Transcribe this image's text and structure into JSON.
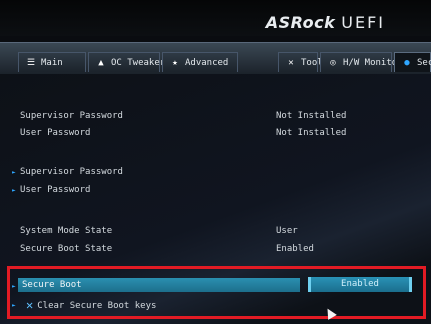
{
  "header": {
    "brand_name": "ASRock",
    "product": "UEFI"
  },
  "tabs": [
    {
      "label": "Main",
      "icon": "list-icon"
    },
    {
      "label": "OC Tweaker",
      "icon": "rocket-icon"
    },
    {
      "label": "Advanced",
      "icon": "star-icon"
    },
    {
      "label": "Tool",
      "icon": "tool-icon"
    },
    {
      "label": "H/W Monitor",
      "icon": "monitor-icon"
    },
    {
      "label": "Sec",
      "icon": "shield-icon"
    }
  ],
  "settings": {
    "supervisor_password_status_label": "Supervisor Password",
    "supervisor_password_status_value": "Not Installed",
    "user_password_status_label": "User Password",
    "user_password_status_value": "Not Installed",
    "set_supervisor_password_label": "Supervisor Password",
    "set_user_password_label": "User Password",
    "system_mode_state_label": "System Mode State",
    "system_mode_state_value": "User",
    "secure_boot_state_label": "Secure Boot State",
    "secure_boot_state_value": "Enabled",
    "secure_boot_label": "Secure Boot",
    "secure_boot_value": "Enabled",
    "clear_keys_label": "Clear Secure Boot keys"
  },
  "colors": {
    "accent": "#2ea6ff",
    "highlight_border": "#e21b24",
    "selection": "#1d6f8c"
  }
}
